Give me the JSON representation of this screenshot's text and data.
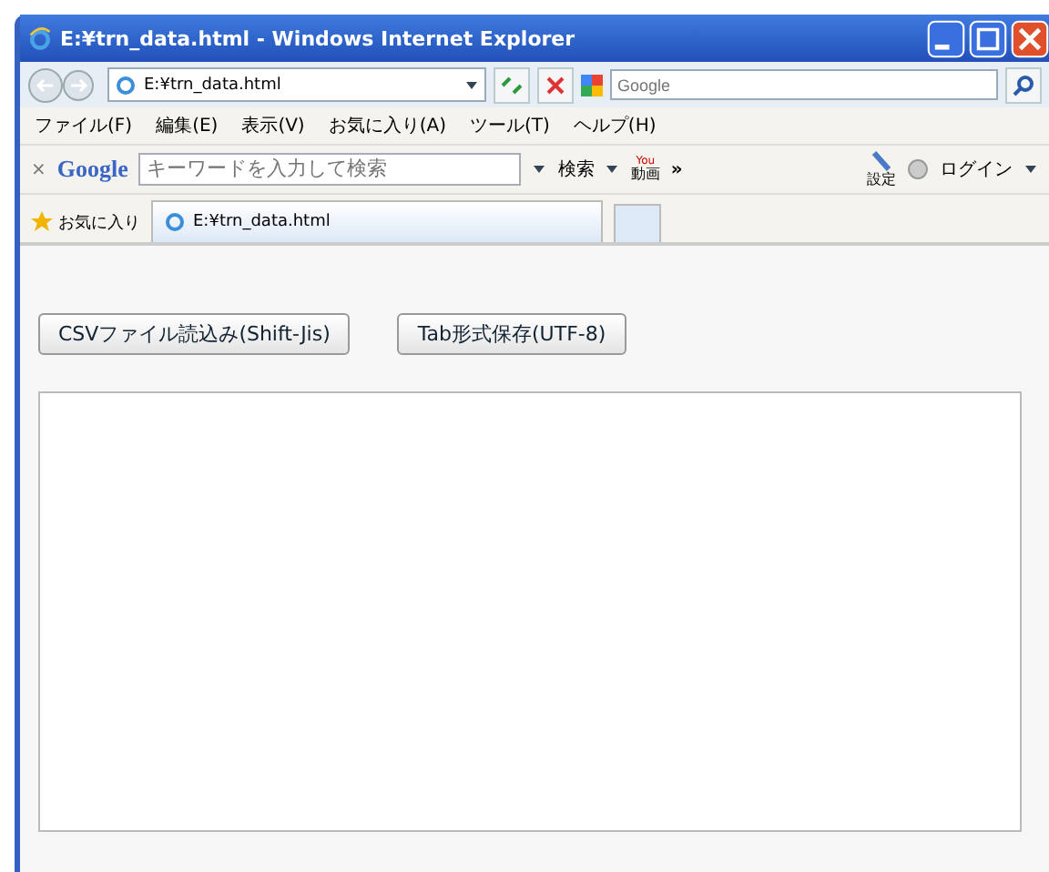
{
  "window": {
    "title": "E:¥trn_data.html - Windows Internet Explorer"
  },
  "address_bar": {
    "value": "E:¥trn_data.html"
  },
  "search_box": {
    "placeholder": "Google"
  },
  "menu": [
    "ファイル(F)",
    "編集(E)",
    "表示(V)",
    "お気に入り(A)",
    "ツール(T)",
    "ヘルプ(H)"
  ],
  "google_toolbar": {
    "close": "×",
    "logo": "Google",
    "placeholder": "キーワードを入力して検索",
    "search": "検索",
    "video_top": "You",
    "video": "動画",
    "more": "»",
    "settings": "設定",
    "login": "ログイン"
  },
  "favorites": {
    "label": "お気に入り"
  },
  "tabs": [
    {
      "label": "E:¥trn_data.html",
      "selected": true
    }
  ],
  "page": {
    "buttons": [
      "CSVファイル読込み(Shift-Jis)",
      "Tab形式保存(UTF-8)"
    ]
  }
}
